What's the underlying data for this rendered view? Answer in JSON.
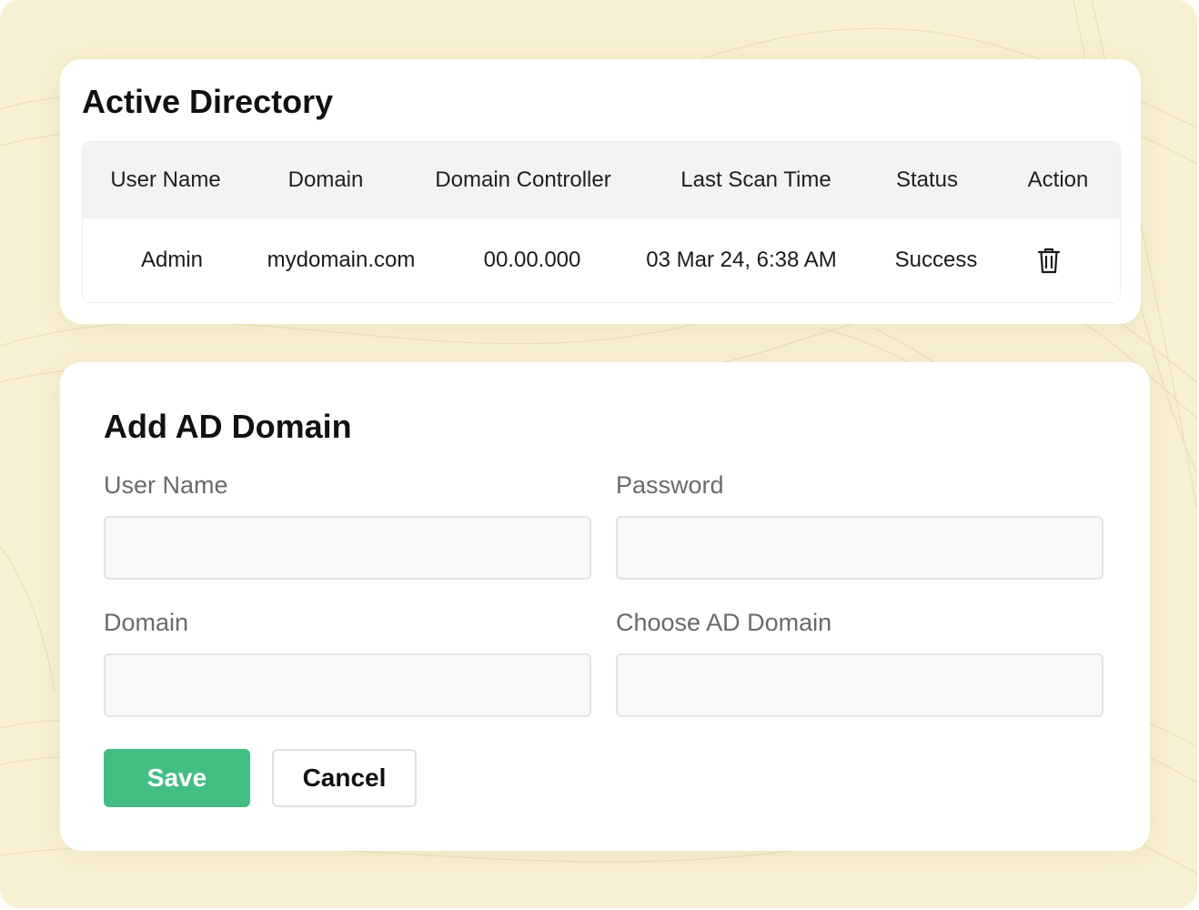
{
  "active_directory": {
    "title": "Active Directory",
    "columns": [
      "User Name",
      "Domain",
      "Domain Controller",
      "Last Scan Time",
      "Status",
      "Action"
    ],
    "rows": [
      {
        "user_name": "Admin",
        "domain": "mydomain.com",
        "domain_controller": "00.00.000",
        "last_scan_time": "03 Mar 24, 6:38 AM",
        "status": "Success",
        "action_icon": "trash-icon"
      }
    ]
  },
  "add_ad_domain": {
    "title": "Add AD Domain",
    "fields": {
      "user_name": {
        "label": "User Name",
        "value": "",
        "placeholder": ""
      },
      "password": {
        "label": "Password",
        "value": "",
        "placeholder": ""
      },
      "domain": {
        "label": "Domain",
        "value": "",
        "placeholder": ""
      },
      "choose_ad_domain": {
        "label": "Choose AD Domain",
        "value": "",
        "placeholder": ""
      }
    },
    "buttons": {
      "save": "Save",
      "cancel": "Cancel"
    }
  },
  "colors": {
    "background": "#f7f0d2",
    "save_button": "#43be83",
    "card": "#ffffff",
    "table_header": "#f3f3f3"
  }
}
